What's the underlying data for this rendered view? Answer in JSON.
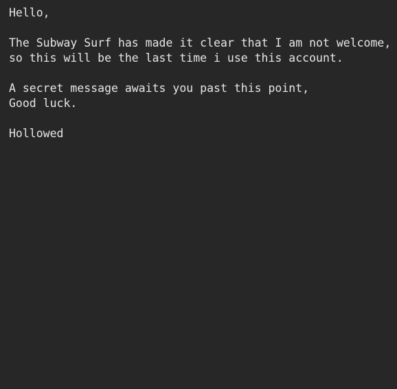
{
  "document": {
    "lines": [
      "Hello,",
      "",
      "The Subway Surf has made it clear that I am not welcome,",
      "so this will be the last time i use this account.",
      "",
      "A secret message awaits you past this point,",
      "Good luck.",
      "",
      "Hollowed"
    ]
  },
  "colors": {
    "background": "#272727",
    "text": "#e6e6e6"
  }
}
